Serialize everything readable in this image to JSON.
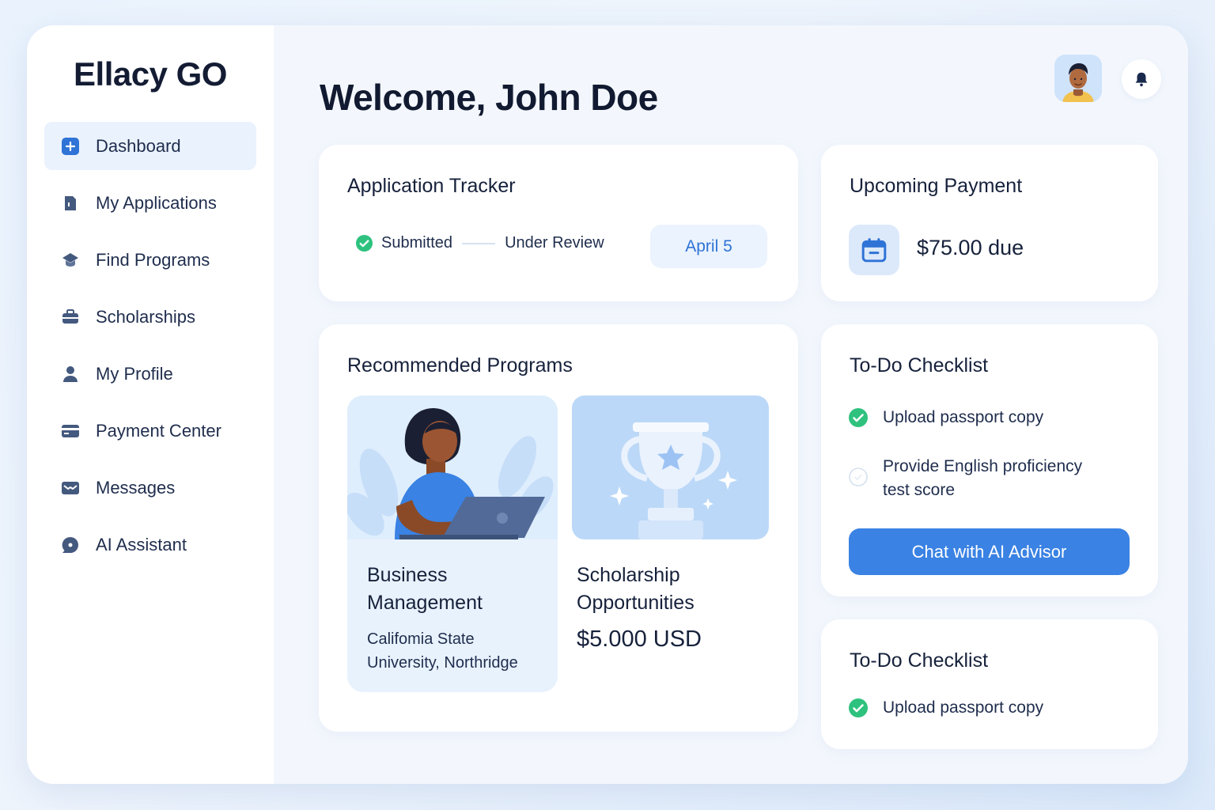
{
  "brand": "Ellacy GO",
  "sidebar": {
    "items": [
      {
        "label": "Dashboard",
        "icon": "plus-square-icon",
        "active": true
      },
      {
        "label": "My Applications",
        "icon": "document-icon"
      },
      {
        "label": "Find Programs",
        "icon": "graduation-cap-icon"
      },
      {
        "label": "Scholarships",
        "icon": "briefcase-icon"
      },
      {
        "label": "My Profile",
        "icon": "user-icon"
      },
      {
        "label": "Payment Center",
        "icon": "credit-card-icon"
      },
      {
        "label": "Messages",
        "icon": "envelope-icon"
      },
      {
        "label": "AI Assistant",
        "icon": "chat-bubble-icon"
      }
    ]
  },
  "header": {
    "welcome": "Welcome, John Doe"
  },
  "tracker": {
    "title": "Application Tracker",
    "step_done": "Submitted",
    "step_current": "Under Review",
    "date": "April 5"
  },
  "payment": {
    "title": "Upcoming Payment",
    "amount": "$75.00 due"
  },
  "recommended": {
    "title": "Recommended Programs",
    "program": {
      "name": "Business Management",
      "school": "Califomia State University, Northridge"
    },
    "scholarship": {
      "name": "Scholarship Opportunities",
      "amount": "$5.000 USD"
    }
  },
  "todo1": {
    "title": "To-Do Checklist",
    "items": [
      {
        "text": "Upload passport copy",
        "done": true
      },
      {
        "text": "Provide English proficiency test score",
        "done": false
      }
    ],
    "button": "Chat with AI Advisor"
  },
  "todo2": {
    "title": "To-Do Checklist",
    "items": [
      {
        "text": "Upload passport copy",
        "done": true
      }
    ]
  },
  "colors": {
    "accent": "#3a82e3",
    "success": "#2ec27e",
    "sidebar_active": "#eaf2fd",
    "background": "#f3f7fd"
  }
}
